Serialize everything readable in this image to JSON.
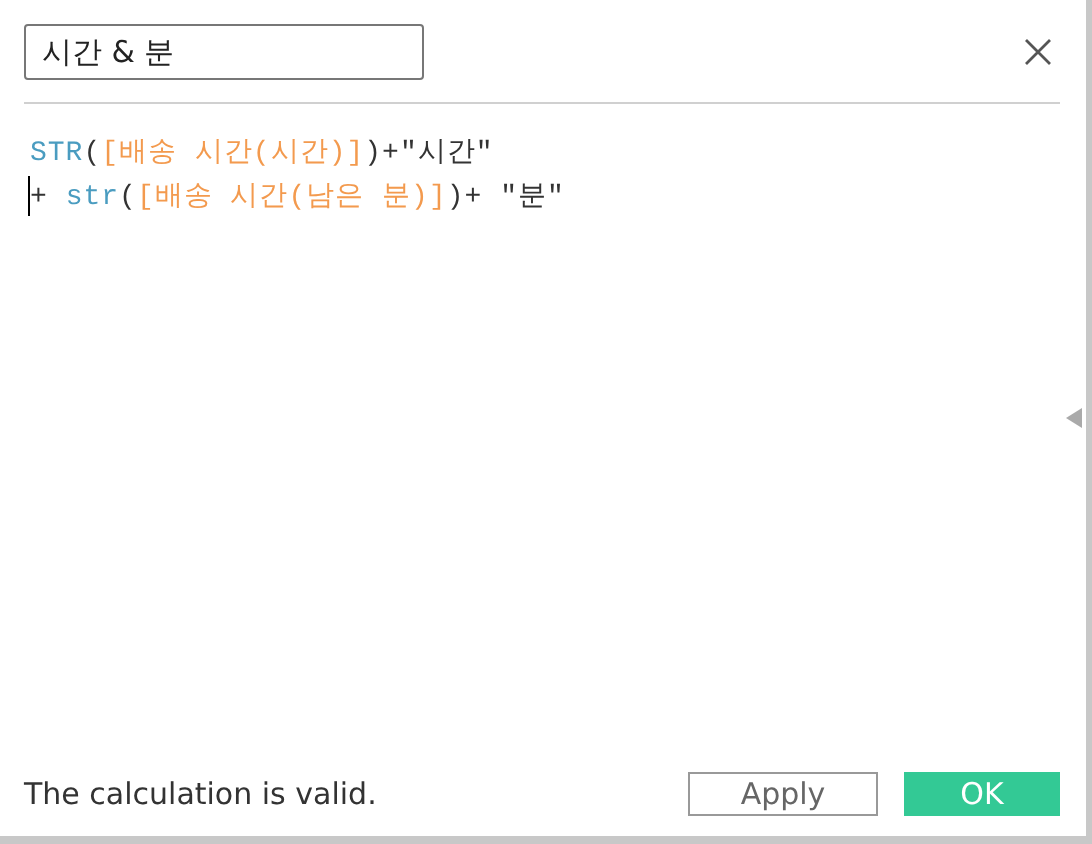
{
  "name_field": {
    "value": "시간 & 분"
  },
  "formula": {
    "lines": [
      [
        {
          "kind": "func",
          "text": "STR"
        },
        {
          "kind": "paren",
          "text": "("
        },
        {
          "kind": "field",
          "text": "[배송 시간(시간)]"
        },
        {
          "kind": "paren",
          "text": ")"
        },
        {
          "kind": "op",
          "text": "+"
        },
        {
          "kind": "string",
          "text": "\"시간\""
        }
      ],
      [
        {
          "kind": "op",
          "text": "+ "
        },
        {
          "kind": "func",
          "text": "str"
        },
        {
          "kind": "paren",
          "text": "("
        },
        {
          "kind": "field",
          "text": "[배송 시간(남은 분)]"
        },
        {
          "kind": "paren",
          "text": ")"
        },
        {
          "kind": "op",
          "text": "+ "
        },
        {
          "kind": "string",
          "text": "\"분\""
        }
      ]
    ]
  },
  "status": "The calculation is valid.",
  "buttons": [
    {
      "label": "Apply",
      "kind": "secondary"
    },
    {
      "label": "OK",
      "kind": "primary"
    }
  ]
}
